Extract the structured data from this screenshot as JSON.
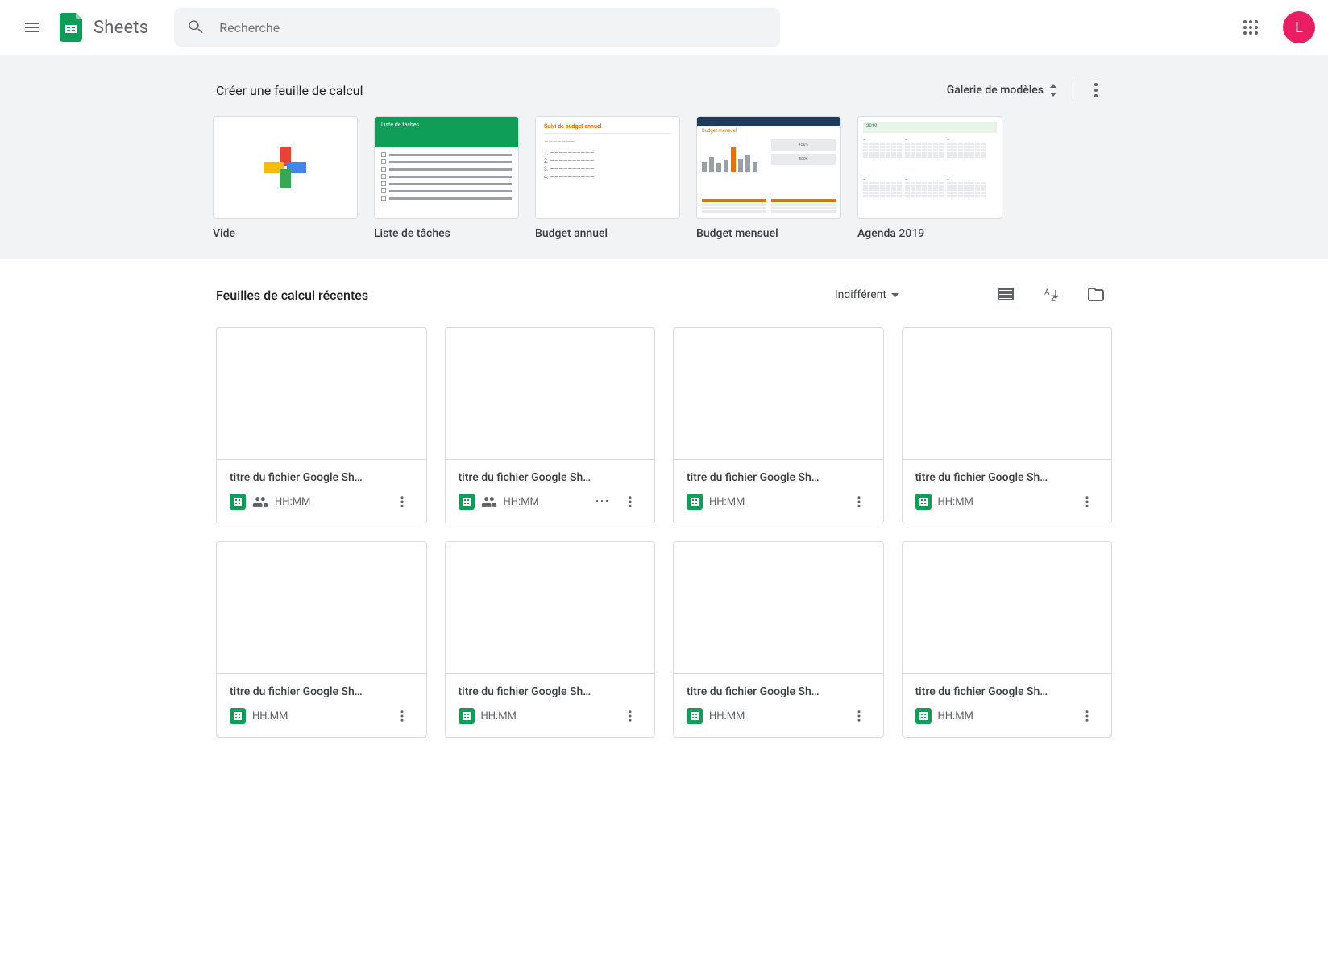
{
  "header": {
    "app_name": "Sheets",
    "search_placeholder": "Recherche",
    "avatar_initial": "L"
  },
  "templates": {
    "section_title": "Créer une feuille de calcul",
    "gallery_button": "Galerie de modèles",
    "items": [
      {
        "label": "Vide",
        "kind": "blank"
      },
      {
        "label": "Liste de tâches",
        "kind": "todo",
        "thumb_title": "Liste de tâches"
      },
      {
        "label": "Budget annuel",
        "kind": "annual",
        "thumb_title": "Suivi de budget annuel"
      },
      {
        "label": "Budget mensuel",
        "kind": "monthly",
        "thumb_title": "Budget mensuel"
      },
      {
        "label": "Agenda 2019",
        "kind": "agenda",
        "thumb_year": "2019"
      }
    ]
  },
  "recent": {
    "section_title": "Feuilles de calcul récentes",
    "owner_filter_label": "Indifférent",
    "docs": [
      {
        "title": "titre du fichier Google Sh…",
        "time": "HH:MM",
        "shared": true,
        "offline": false
      },
      {
        "title": "titre du fichier Google Sh…",
        "time": "HH:MM",
        "shared": true,
        "offline": true
      },
      {
        "title": "titre du fichier Google Sh…",
        "time": "HH:MM",
        "shared": false,
        "offline": false
      },
      {
        "title": "titre du fichier Google Sh…",
        "time": "HH:MM",
        "shared": false,
        "offline": false
      },
      {
        "title": "titre du fichier Google Sh…",
        "time": "HH:MM",
        "shared": false,
        "offline": false
      },
      {
        "title": "titre du fichier Google Sh…",
        "time": "HH:MM",
        "shared": false,
        "offline": false
      },
      {
        "title": "titre du fichier Google Sh…",
        "time": "HH:MM",
        "shared": false,
        "offline": false
      },
      {
        "title": "titre du fichier Google Sh…",
        "time": "HH:MM",
        "shared": false,
        "offline": false
      }
    ]
  }
}
